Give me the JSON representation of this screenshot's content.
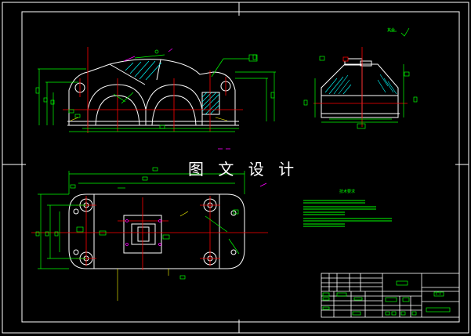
{
  "watermark": {
    "text": "图 文 设 计"
  },
  "notes": {
    "title": "技术要求",
    "roughness_mark": "其余"
  },
  "title_block": {
    "ratio": "1:1"
  },
  "colors": {
    "background": "#000000",
    "outline": "#ffffff",
    "dimension": "#00ff00",
    "centerline": "#ff0000",
    "hatch": "#00ffff",
    "text_block": "#00ff00",
    "accent": "#ff00ff",
    "leader": "#ffff00"
  }
}
